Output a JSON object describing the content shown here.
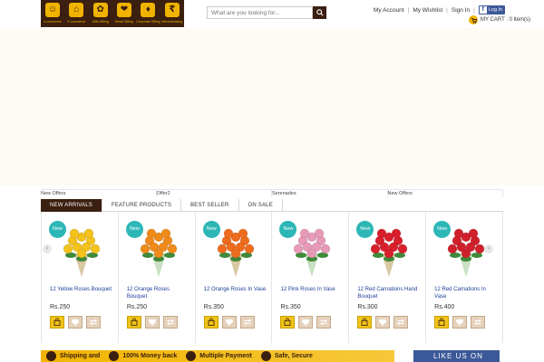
{
  "header": {
    "logo_items": [
      {
        "caption": "e-commerce",
        "glyph": "☺"
      },
      {
        "caption": "E-commerce",
        "glyph": "⌂"
      },
      {
        "caption": "Gifts Gifting",
        "glyph": "✿"
      },
      {
        "caption": "Retail Gifting",
        "glyph": "❤"
      },
      {
        "caption": "Corporate Gifting",
        "glyph": "♦"
      },
      {
        "caption": "Merchandising",
        "glyph": "₹"
      }
    ],
    "search": {
      "placeholder": "What are you looking for...",
      "icon": "search-icon"
    },
    "links": {
      "my_account": "My Account",
      "my_wishlist": "My Wishlist",
      "sign_in": "Sign In",
      "separator": "|",
      "fb_login": "Log In"
    },
    "cart": {
      "label": "MY CART : 0 item(s)"
    }
  },
  "offers": [
    "New Offers",
    "Offer2",
    "Serenades",
    "New Offers"
  ],
  "tabs": [
    {
      "label": "NEW ARRIVALS",
      "active": true
    },
    {
      "label": "FEATURE PRODUCTS",
      "active": false
    },
    {
      "label": "BEST SELLER",
      "active": false
    },
    {
      "label": "ON SALE",
      "active": false
    }
  ],
  "products": [
    {
      "badge": "New",
      "name": "12 Yellow Roses Bouquet",
      "price": "Rs.250",
      "flower": "#f3c21b"
    },
    {
      "badge": "New",
      "name": "12 Orange Roses Bouquet",
      "price": "Rs.250",
      "flower": "#f08a1a"
    },
    {
      "badge": "New",
      "name": "12 Orange Roses In Vase",
      "price": "Rs.350",
      "flower": "#ef6b1d"
    },
    {
      "badge": "New",
      "name": "12 Pink Roses In Vase",
      "price": "Rs.350",
      "flower": "#e79ab7"
    },
    {
      "badge": "New",
      "name": "12 Red Carnations Hand Bouquet",
      "price": "Rs.300",
      "flower": "#d81f2c"
    },
    {
      "badge": "New",
      "name": "12 Red Carnations In Vase",
      "price": "Rs.400",
      "flower": "#d0202c"
    }
  ],
  "bottom_strip": [
    "Shipping and",
    "100% Money back",
    "Multiple Payment",
    "Safe, Secure"
  ],
  "like_us": "LIKE US ON",
  "colors": {
    "brand_brown": "#3b1f10",
    "brand_yellow": "#f0b400",
    "badge_teal": "#2db6b6",
    "link_blue": "#1f3f9a",
    "facebook": "#3b5998"
  }
}
